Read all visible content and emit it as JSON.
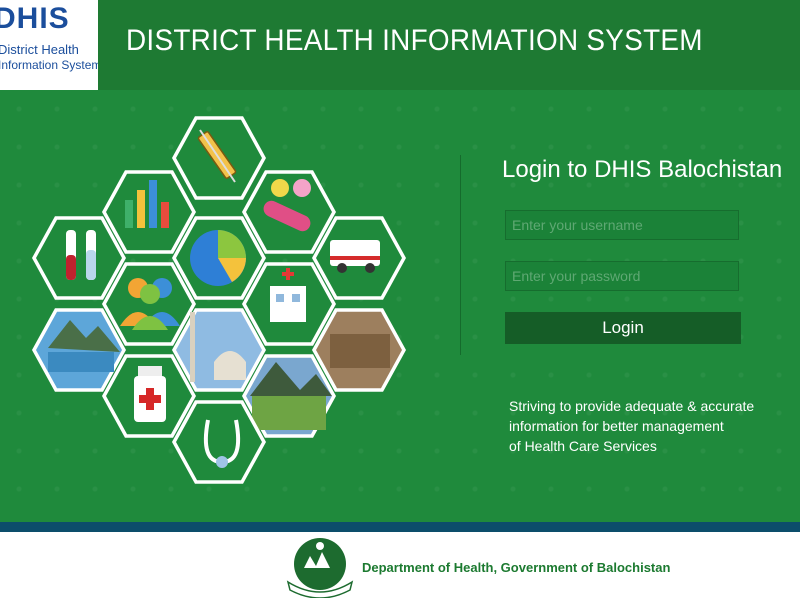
{
  "header": {
    "logo_text": "DHIS",
    "logo_line1": "District Health",
    "logo_line2": "Information System",
    "title": "DISTRICT HEALTH INFORMATION SYSTEM"
  },
  "login": {
    "title": "Login to DHIS Balochistan",
    "username_placeholder": "Enter your username",
    "username_value": "",
    "password_placeholder": "Enter your password",
    "password_value": "",
    "button_label": "Login"
  },
  "tagline": {
    "line1": "Striving to provide adequate & accurate",
    "line2": "information for better management",
    "line3": "of Health Care Services"
  },
  "footer": {
    "text": "Department of Health, Government of Balochistan"
  },
  "colors": {
    "header_green": "#1e7a33",
    "body_green": "#1f8a3c",
    "button_green": "#155d27",
    "stripe_blue": "#0c4d6b",
    "logo_blue": "#1b4e9c"
  },
  "icons": [
    "syringe-icon",
    "bar-chart-icon",
    "pills-icon",
    "test-tubes-icon",
    "pie-chart-icon",
    "ambulance-icon",
    "people-icon",
    "hospital-icon",
    "mountain-lake-icon",
    "mosque-icon",
    "fort-icon",
    "medicine-bottle-icon",
    "valley-icon",
    "stethoscope-icon"
  ]
}
